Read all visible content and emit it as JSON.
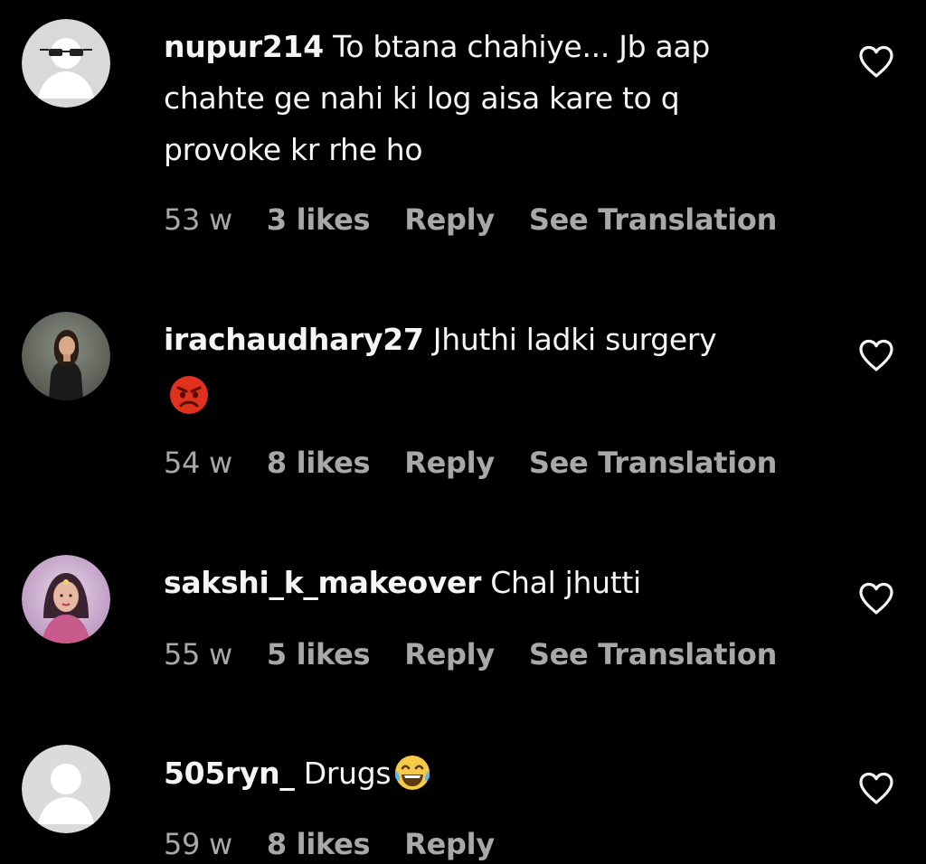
{
  "comments": [
    {
      "username": "nupur214",
      "text": "To btana chahiye... Jb aap",
      "text_line2": "chahte ge nahi ki log aisa kare to q",
      "text_line3": "provoke kr rhe ho",
      "time": "53 w",
      "likes": "3 likes",
      "reply": "Reply",
      "translate": "See Translation",
      "avatar": "sunglasses-avatar-icon",
      "like_icon": "heart-outline-icon"
    },
    {
      "username": "irachaudhary27",
      "text": "Jhuthi ladki surgery",
      "emoji": "angry-face-emoji",
      "time": "54 w",
      "likes": "8 likes",
      "reply": "Reply",
      "translate": "See Translation",
      "avatar": "profile-photo",
      "like_icon": "heart-outline-icon"
    },
    {
      "username": "sakshi_k_makeover",
      "text": "Chal jhutti",
      "time": "55 w",
      "likes": "5 likes",
      "reply": "Reply",
      "translate": "See Translation",
      "avatar": "profile-photo",
      "like_icon": "heart-outline-icon"
    },
    {
      "username": "505ryn_",
      "text": "Drugs",
      "emoji": "tears-of-joy-emoji",
      "time": "59 w",
      "likes": "8 likes",
      "reply": "Reply",
      "avatar": "default-avatar-icon",
      "like_icon": "heart-outline-icon"
    }
  ],
  "colors": {
    "background": "#000000",
    "primary_text": "#f5f5f5",
    "secondary_text": "#a8a8a8",
    "default_avatar": "#dbdbdb",
    "angry_emoji": "#e0301e",
    "joy_emoji": "#f7c948"
  }
}
